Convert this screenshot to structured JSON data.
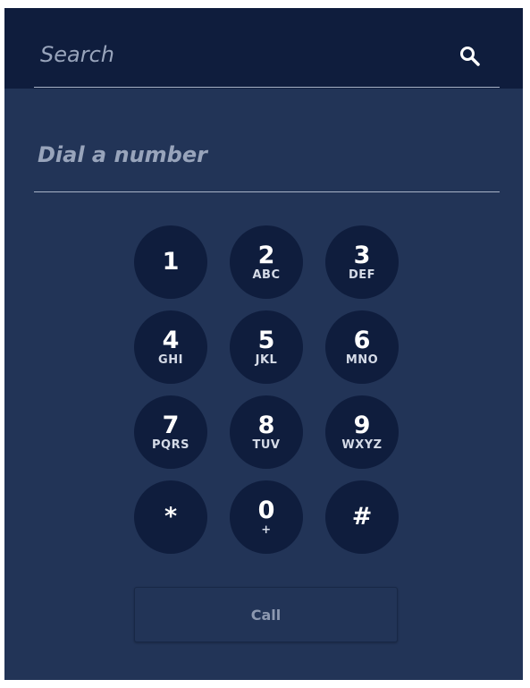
{
  "search": {
    "placeholder": "Search",
    "icon": "search-icon"
  },
  "dial": {
    "placeholder": "Dial a number"
  },
  "keypad": {
    "keys": [
      {
        "digit": "1",
        "letters": ""
      },
      {
        "digit": "2",
        "letters": "ABC"
      },
      {
        "digit": "3",
        "letters": "DEF"
      },
      {
        "digit": "4",
        "letters": "GHI"
      },
      {
        "digit": "5",
        "letters": "JKL"
      },
      {
        "digit": "6",
        "letters": "MNO"
      },
      {
        "digit": "7",
        "letters": "PQRS"
      },
      {
        "digit": "8",
        "letters": "TUV"
      },
      {
        "digit": "9",
        "letters": "WXYZ"
      },
      {
        "digit": "*",
        "letters": ""
      },
      {
        "digit": "0",
        "letters": "+"
      },
      {
        "digit": "#",
        "letters": ""
      }
    ]
  },
  "call_button": {
    "label": "Call"
  },
  "colors": {
    "panel_background": "#223457",
    "header_background": "#0f1d3d",
    "key_background": "#0f1d3d",
    "placeholder_text": "#98a4bb",
    "divider": "#a8b3c7"
  }
}
